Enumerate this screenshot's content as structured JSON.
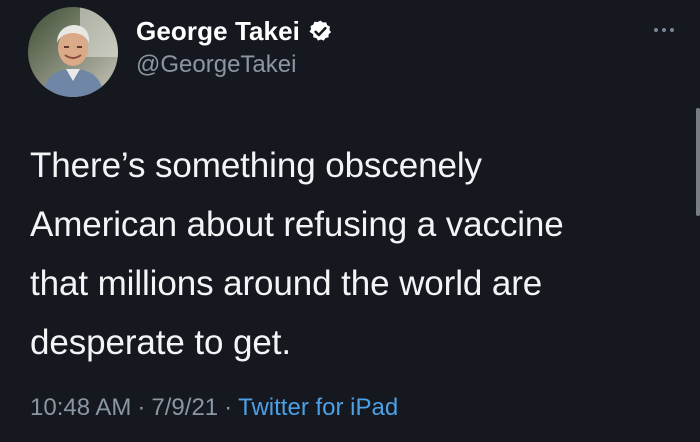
{
  "tweet": {
    "author": {
      "display_name": "George Takei",
      "handle": "@GeorgeTakei",
      "verified": true,
      "avatar_icon": "profile-photo"
    },
    "text_lines": [
      "There’s something obscenely",
      "American about refusing a vaccine",
      "that millions around the world are",
      "desperate to get."
    ],
    "time": "10:48 AM",
    "date": "7/9/21",
    "separator": "·",
    "source": "Twitter for iPad"
  },
  "colors": {
    "background": "#15181f",
    "handle": "#8b96a3",
    "link": "#4ba0e6",
    "verified_badge": "#ffffff"
  }
}
